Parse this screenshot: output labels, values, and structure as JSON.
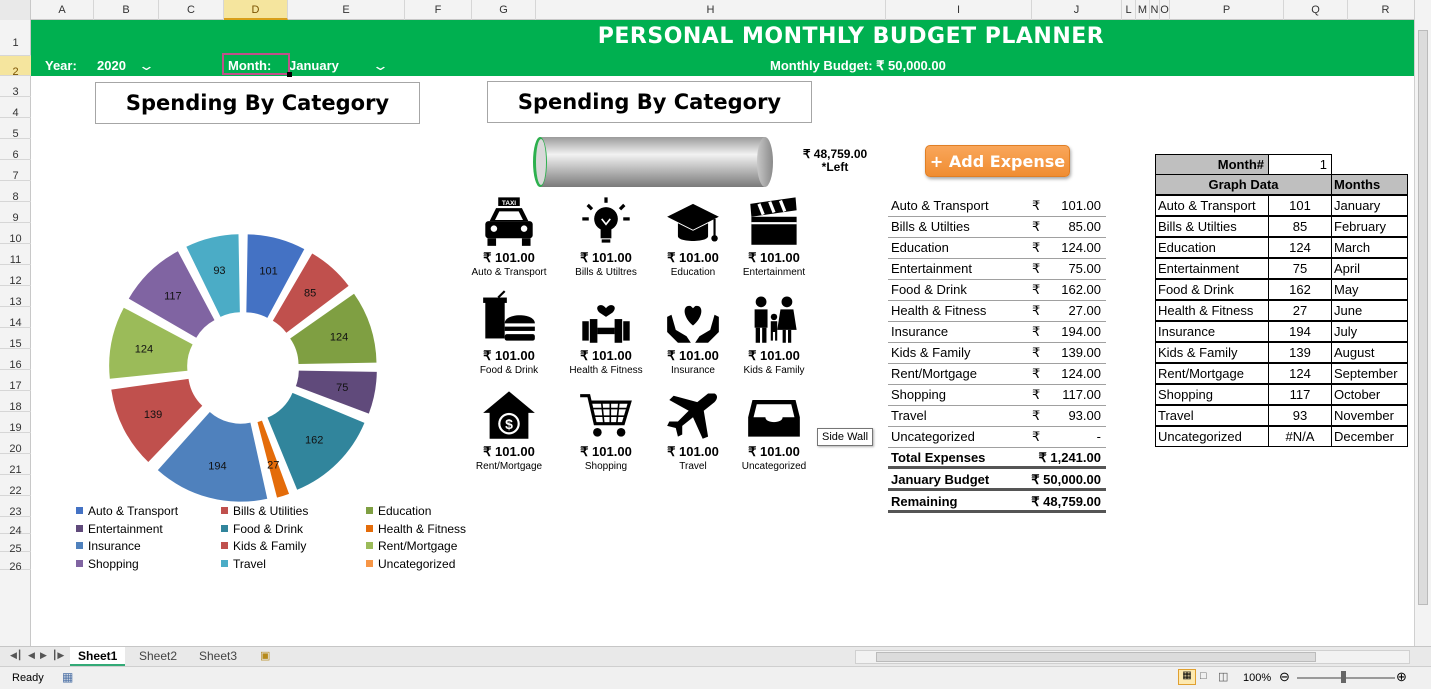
{
  "columns": [
    "A",
    "B",
    "C",
    "D",
    "E",
    "F",
    "G",
    "H",
    "I",
    "J",
    "L",
    "M",
    "N",
    "O",
    "P",
    "Q",
    "R"
  ],
  "rows": [
    "1",
    "2",
    "3",
    "4",
    "5",
    "6",
    "7",
    "8",
    "9",
    "10",
    "11",
    "12",
    "13",
    "14",
    "15",
    "16",
    "17",
    "18",
    "19",
    "20",
    "21",
    "22",
    "23",
    "24",
    "25",
    "26"
  ],
  "header": {
    "title": "PERSONAL MONTHLY BUDGET PLANNER",
    "year_label": "Year:",
    "year_value": "2020",
    "month_label": "Month:",
    "month_value": "January",
    "budget_text": "Monthly Budget: ₹ 50,000.00"
  },
  "chart_titles": [
    "Spending By Category",
    "Spending By Category"
  ],
  "chart_data": {
    "type": "pie",
    "categories": [
      "Auto & Transport",
      "Bills & Utilities",
      "Education",
      "Entertainment",
      "Food & Drink",
      "Health & Fitness",
      "Insurance",
      "Kids & Family",
      "Rent/Mortgage",
      "Shopping",
      "Travel",
      "Uncategorized"
    ],
    "values": [
      101,
      85,
      124,
      75,
      162,
      27,
      194,
      139,
      124,
      117,
      93,
      0
    ],
    "colors": [
      "#4472c4",
      "#c0504d",
      "#7f9f42",
      "#604a7b",
      "#31859c",
      "#e46c0a",
      "#4f81bd",
      "#c0504d",
      "#9bbb59",
      "#8064a2",
      "#4bacc6",
      "#f79646"
    ],
    "legend_position": "bottom"
  },
  "legend": [
    "Auto & Transport",
    "Bills & Utilities",
    "Education",
    "Entertainment",
    "Food & Drink",
    "Health & Fitness",
    "Insurance",
    "Kids & Family",
    "Rent/Mortgage",
    "Shopping",
    "Travel",
    "Uncategorized"
  ],
  "progress": {
    "left_amount": "₹ 48,759.00",
    "left_label": "*Left",
    "remaining_fraction": 0.975
  },
  "tiles": [
    {
      "icon": "taxi-icon",
      "amount": "₹ 101.00",
      "label": "Auto & Transport"
    },
    {
      "icon": "lightbulb-icon",
      "amount": "₹ 101.00",
      "label": "Bills & Utiltres"
    },
    {
      "icon": "graduation-cap-icon",
      "amount": "₹ 101.00",
      "label": "Education"
    },
    {
      "icon": "clapperboard-icon",
      "amount": "₹ 101.00",
      "label": "Entertainment"
    },
    {
      "icon": "food-icon",
      "amount": "₹ 101.00",
      "label": "Food & Drink"
    },
    {
      "icon": "dumbbell-icon",
      "amount": "₹ 101.00",
      "label": "Health & Fitness"
    },
    {
      "icon": "insurance-hands-icon",
      "amount": "₹ 101.00",
      "label": "Insurance"
    },
    {
      "icon": "family-icon",
      "amount": "₹ 101.00",
      "label": "Kids & Family"
    },
    {
      "icon": "house-dollar-icon",
      "amount": "₹ 101.00",
      "label": "Rent/Mortgage"
    },
    {
      "icon": "cart-icon",
      "amount": "₹ 101.00",
      "label": "Shopping"
    },
    {
      "icon": "airplane-icon",
      "amount": "₹ 101.00",
      "label": "Travel"
    },
    {
      "icon": "inbox-icon",
      "amount": "₹ 101.00",
      "label": "Uncategorized"
    }
  ],
  "tooltip": "Side Wall",
  "add_button": "+ Add Expense",
  "expenses": [
    {
      "name": "Auto & Transport",
      "cur": "₹",
      "value": "101.00"
    },
    {
      "name": "Bills & Utilties",
      "cur": "₹",
      "value": "85.00"
    },
    {
      "name": "Education",
      "cur": "₹",
      "value": "124.00"
    },
    {
      "name": "Entertainment",
      "cur": "₹",
      "value": "75.00"
    },
    {
      "name": "Food & Drink",
      "cur": "₹",
      "value": "162.00"
    },
    {
      "name": "Health & Fitness",
      "cur": "₹",
      "value": "27.00"
    },
    {
      "name": "Insurance",
      "cur": "₹",
      "value": "194.00"
    },
    {
      "name": "Kids & Family",
      "cur": "₹",
      "value": "139.00"
    },
    {
      "name": "Rent/Mortgage",
      "cur": "₹",
      "value": "124.00"
    },
    {
      "name": "Shopping",
      "cur": "₹",
      "value": "117.00"
    },
    {
      "name": "Travel",
      "cur": "₹",
      "value": "93.00"
    },
    {
      "name": "Uncategorized",
      "cur": "₹",
      "value": "-"
    }
  ],
  "totals": {
    "total_label": "Total Expenses",
    "total_value": "₹   1,241.00",
    "budget_label": "January Budget",
    "budget_value": "₹ 50,000.00",
    "remaining_label": "Remaining",
    "remaining_value": "₹ 48,759.00"
  },
  "graph_table": {
    "month_num_label": "Month#",
    "month_num_value": "1",
    "graph_header": "Graph Data",
    "months_header": "Months",
    "rows": [
      {
        "cat": "Auto & Transport",
        "val": "101",
        "month": "January"
      },
      {
        "cat": "Bills & Utilties",
        "val": "85",
        "month": "February"
      },
      {
        "cat": "Education",
        "val": "124",
        "month": "March"
      },
      {
        "cat": "Entertainment",
        "val": "75",
        "month": "April"
      },
      {
        "cat": "Food & Drink",
        "val": "162",
        "month": "May"
      },
      {
        "cat": "Health & Fitness",
        "val": "27",
        "month": "June"
      },
      {
        "cat": "Insurance",
        "val": "194",
        "month": "July"
      },
      {
        "cat": "Kids & Family",
        "val": "139",
        "month": "August"
      },
      {
        "cat": "Rent/Mortgage",
        "val": "124",
        "month": "September"
      },
      {
        "cat": "Shopping",
        "val": "117",
        "month": "October"
      },
      {
        "cat": "Travel",
        "val": "93",
        "month": "November"
      },
      {
        "cat": "Uncategorized",
        "val": "#N/A",
        "month": "December"
      }
    ]
  },
  "sheets": [
    "Sheet1",
    "Sheet2",
    "Sheet3"
  ],
  "status": {
    "ready": "Ready",
    "zoom": "100%"
  }
}
